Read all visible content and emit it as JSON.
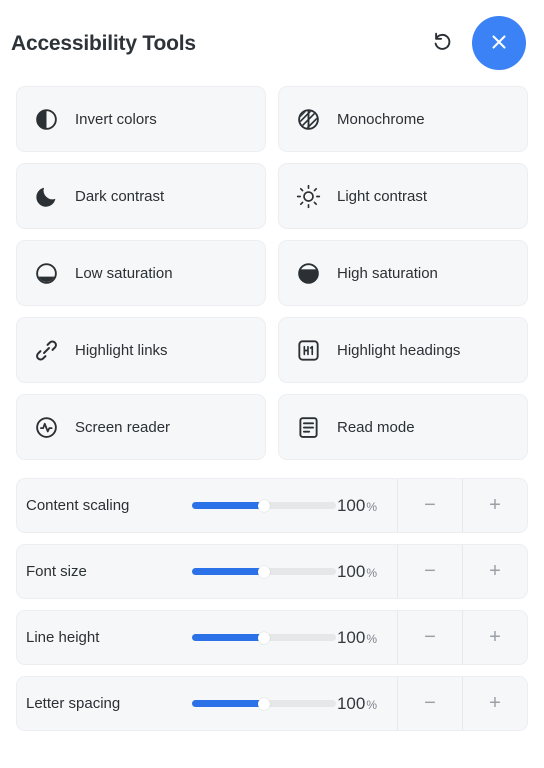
{
  "header": {
    "title": "Accessibility Tools",
    "reset_icon": "reset-arrow-icon",
    "close_icon": "close-icon",
    "accent_color": "#3b82f6"
  },
  "toggles": [
    {
      "label": "Invert colors",
      "icon": "invert-colors-icon"
    },
    {
      "label": "Monochrome",
      "icon": "monochrome-icon"
    },
    {
      "label": "Dark contrast",
      "icon": "moon-icon"
    },
    {
      "label": "Light contrast",
      "icon": "sun-icon"
    },
    {
      "label": "Low saturation",
      "icon": "low-saturation-icon"
    },
    {
      "label": "High saturation",
      "icon": "high-saturation-icon"
    },
    {
      "label": "Highlight links",
      "icon": "link-icon"
    },
    {
      "label": "Highlight headings",
      "icon": "heading-h1-icon"
    },
    {
      "label": "Screen reader",
      "icon": "screen-reader-icon"
    },
    {
      "label": "Read mode",
      "icon": "read-mode-icon"
    }
  ],
  "sliders": [
    {
      "name": "Content scaling",
      "value": "100",
      "unit": "%",
      "percent": 50,
      "decrease": "−",
      "increase": "+"
    },
    {
      "name": "Font size",
      "value": "100",
      "unit": "%",
      "percent": 50,
      "decrease": "−",
      "increase": "+"
    },
    {
      "name": "Line height",
      "value": "100",
      "unit": "%",
      "percent": 50,
      "decrease": "−",
      "increase": "+"
    },
    {
      "name": "Letter spacing",
      "value": "100",
      "unit": "%",
      "percent": 50,
      "decrease": "−",
      "increase": "+"
    }
  ],
  "colors": {
    "slider_fill": "#2b72e8",
    "slider_track": "#e6e7e9",
    "card_bg": "#f6f7f9",
    "text": "#2b3034"
  }
}
